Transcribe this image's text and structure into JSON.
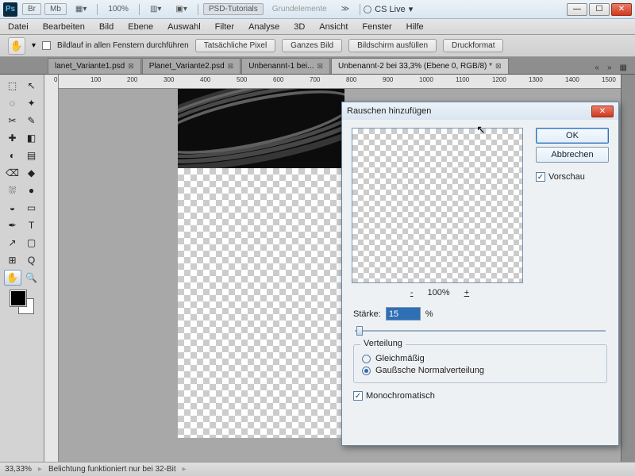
{
  "titlebar": {
    "zoom": "100%",
    "ws1": "PSD-Tutorials",
    "ws2": "Grundelemente",
    "cslive": "CS Live"
  },
  "menu": [
    "Datei",
    "Bearbeiten",
    "Bild",
    "Ebene",
    "Auswahl",
    "Filter",
    "Analyse",
    "3D",
    "Ansicht",
    "Fenster",
    "Hilfe"
  ],
  "optbar": {
    "scroll_chk": "Bildlauf in allen Fenstern durchführen",
    "b1": "Tatsächliche Pixel",
    "b2": "Ganzes Bild",
    "b3": "Bildschirm ausfüllen",
    "b4": "Druckformat"
  },
  "tabs": [
    {
      "label": "lanet_Variante1.psd",
      "active": false
    },
    {
      "label": "Planet_Variante2.psd",
      "active": false
    },
    {
      "label": "Unbenannt-1 bei...",
      "active": false
    },
    {
      "label": "Unbenannt-2 bei 33,3% (Ebene 0, RGB/8) *",
      "active": true
    }
  ],
  "ruler_marks": [
    "0",
    "100",
    "200",
    "300",
    "400",
    "500",
    "600",
    "700",
    "800",
    "900",
    "1000",
    "1100",
    "1200",
    "1300",
    "1400",
    "1500"
  ],
  "status": {
    "zoom": "33,33%",
    "msg": "Belichtung funktioniert nur bei 32-Bit"
  },
  "dialog": {
    "title": "Rauschen hinzufügen",
    "ok": "OK",
    "cancel": "Abbrechen",
    "preview_chk": "Vorschau",
    "zoom_pct": "100%",
    "strength_label": "Stärke:",
    "strength_value": "15",
    "percent": "%",
    "group_title": "Verteilung",
    "r1": "Gleichmäßig",
    "r2": "Gaußsche Normalverteilung",
    "mono": "Monochromatisch"
  },
  "tool_icons": [
    "⬚",
    "↖",
    "◌",
    "✦",
    "✂",
    "✎",
    "✚",
    "◧",
    "◐",
    "▤",
    "⌫",
    "◆",
    "⛆",
    "●",
    "◒",
    "▭",
    "✒",
    "T",
    "↗",
    "▢",
    "⊞",
    "Q",
    "✋",
    "🔍"
  ]
}
